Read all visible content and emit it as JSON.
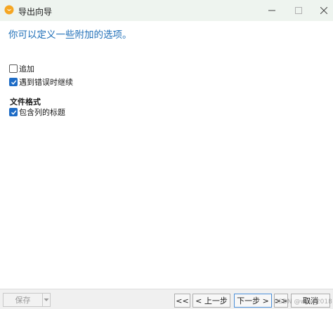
{
  "window": {
    "title": "导出向导",
    "icon": "navicat-app-icon",
    "controls": [
      "minimize-icon",
      "maximize-icon",
      "close-icon"
    ]
  },
  "headline": "你可以定义一些附加的选项。",
  "options": {
    "append": {
      "label": "追加",
      "checked": false
    },
    "continue_on_error": {
      "label": "遇到错误时继续",
      "checked": true
    }
  },
  "file_format": {
    "section_label": "文件格式",
    "include_headers": {
      "label": "包含列的标题",
      "checked": true
    }
  },
  "footer": {
    "save": "保存",
    "first": "<<",
    "prev": "< 上一步",
    "next": "下一步 >",
    "last": ">>",
    "cancel": "取消"
  },
  "watermark": "CSDN @wiai_2018",
  "colors": {
    "headline": "#1f6fb8",
    "checkbox_checked": "#1e6cc6",
    "titlebar_bg": "#eef4ef"
  }
}
